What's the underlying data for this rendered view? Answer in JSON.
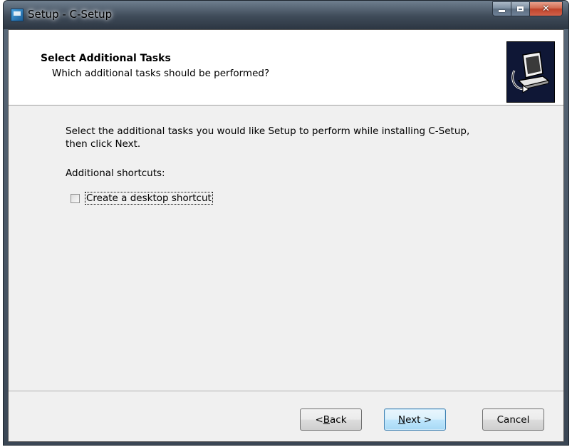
{
  "window": {
    "title": "Setup - C-Setup"
  },
  "header": {
    "title": "Select Additional Tasks",
    "subtitle": "Which additional tasks should be performed?",
    "image_icon": "computer-install-icon"
  },
  "content": {
    "intro_line1": "Select the additional tasks you would like Setup to perform while installing C-Setup,",
    "intro_line2": "then click Next.",
    "section_label": "Additional shortcuts:",
    "tasks": [
      {
        "label": "Create a desktop shortcut",
        "checked": false
      }
    ]
  },
  "buttons": {
    "back_prefix": "< ",
    "back_access": "B",
    "back_rest": "ack",
    "next_access": "N",
    "next_rest": "ext >",
    "cancel": "Cancel"
  },
  "colors": {
    "header_bg": "#ffffff",
    "client_bg": "#f0f0f0",
    "default_button_border": "#3c7fb1",
    "close_button": "#c0432a"
  }
}
